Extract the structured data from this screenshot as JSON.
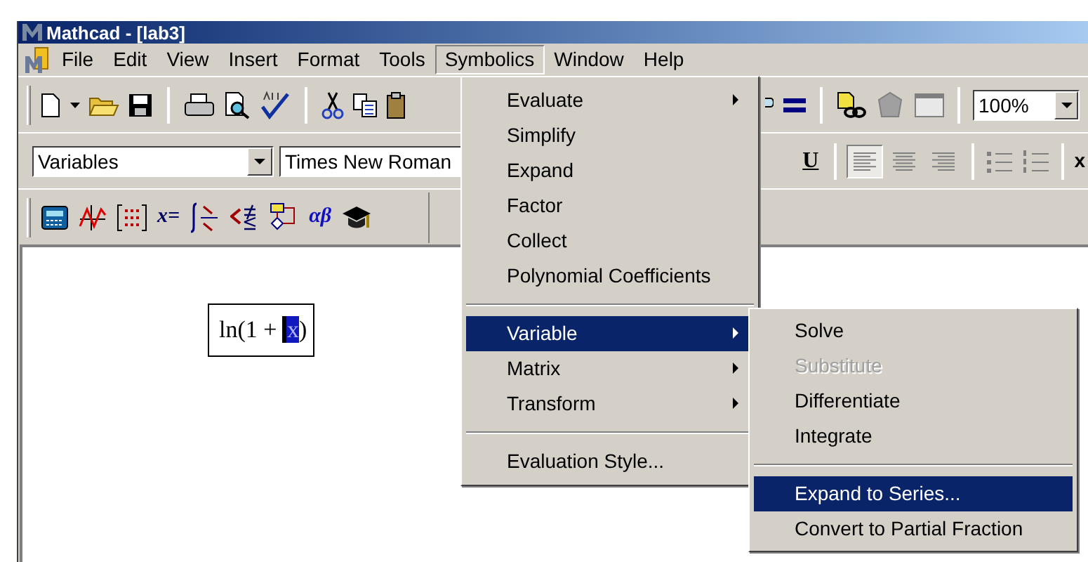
{
  "window": {
    "title": "Mathcad - [lab3]"
  },
  "menu_bar": [
    {
      "label": "File",
      "selected": false
    },
    {
      "label": "Edit",
      "selected": false
    },
    {
      "label": "View",
      "selected": false
    },
    {
      "label": "Insert",
      "selected": false
    },
    {
      "label": "Format",
      "selected": false
    },
    {
      "label": "Tools",
      "selected": false
    },
    {
      "label": "Symbolics",
      "selected": true
    },
    {
      "label": "Window",
      "selected": false
    },
    {
      "label": "Help",
      "selected": false
    }
  ],
  "standard_toolbar": {
    "zoom": "100%"
  },
  "formatting_toolbar": {
    "style": "Variables",
    "font": "Times New Roman",
    "underline": "U",
    "alignment_buttons": [
      {
        "selected": true
      },
      {
        "selected": false
      },
      {
        "selected": false
      }
    ],
    "cut_glyph": "x"
  },
  "math_toolbar": {
    "evaluation_glyph": "x=",
    "greek_glyph": "αβ"
  },
  "worksheet": {
    "expression": {
      "before": "ln(1 + ",
      "cursor_on": "x",
      "after": ")"
    }
  },
  "symbolics_menu": [
    {
      "kind": "item",
      "label": "Evaluate",
      "submenu": true,
      "selected": false
    },
    {
      "kind": "item",
      "label": "Simplify",
      "submenu": false,
      "selected": false
    },
    {
      "kind": "item",
      "label": "Expand",
      "submenu": false,
      "selected": false
    },
    {
      "kind": "item",
      "label": "Factor",
      "submenu": false,
      "selected": false
    },
    {
      "kind": "item",
      "label": "Collect",
      "submenu": false,
      "selected": false
    },
    {
      "kind": "item",
      "label": "Polynomial Coefficients",
      "submenu": false,
      "selected": false
    },
    {
      "kind": "separator"
    },
    {
      "kind": "item",
      "label": "Variable",
      "submenu": true,
      "selected": true
    },
    {
      "kind": "item",
      "label": "Matrix",
      "submenu": true,
      "selected": false
    },
    {
      "kind": "item",
      "label": "Transform",
      "submenu": true,
      "selected": false
    },
    {
      "kind": "separator"
    },
    {
      "kind": "item",
      "label": "Evaluation Style...",
      "submenu": false,
      "selected": false
    }
  ],
  "variable_submenu": [
    {
      "kind": "item",
      "label": "Solve",
      "disabled": false,
      "selected": false
    },
    {
      "kind": "item",
      "label": "Substitute",
      "disabled": true,
      "selected": false
    },
    {
      "kind": "item",
      "label": "Differentiate",
      "disabled": false,
      "selected": false
    },
    {
      "kind": "item",
      "label": "Integrate",
      "disabled": false,
      "selected": false
    },
    {
      "kind": "separator"
    },
    {
      "kind": "item",
      "label": "Expand to Series...",
      "disabled": false,
      "selected": true
    },
    {
      "kind": "item",
      "label": "Convert to Partial Fraction",
      "disabled": false,
      "selected": false
    }
  ]
}
